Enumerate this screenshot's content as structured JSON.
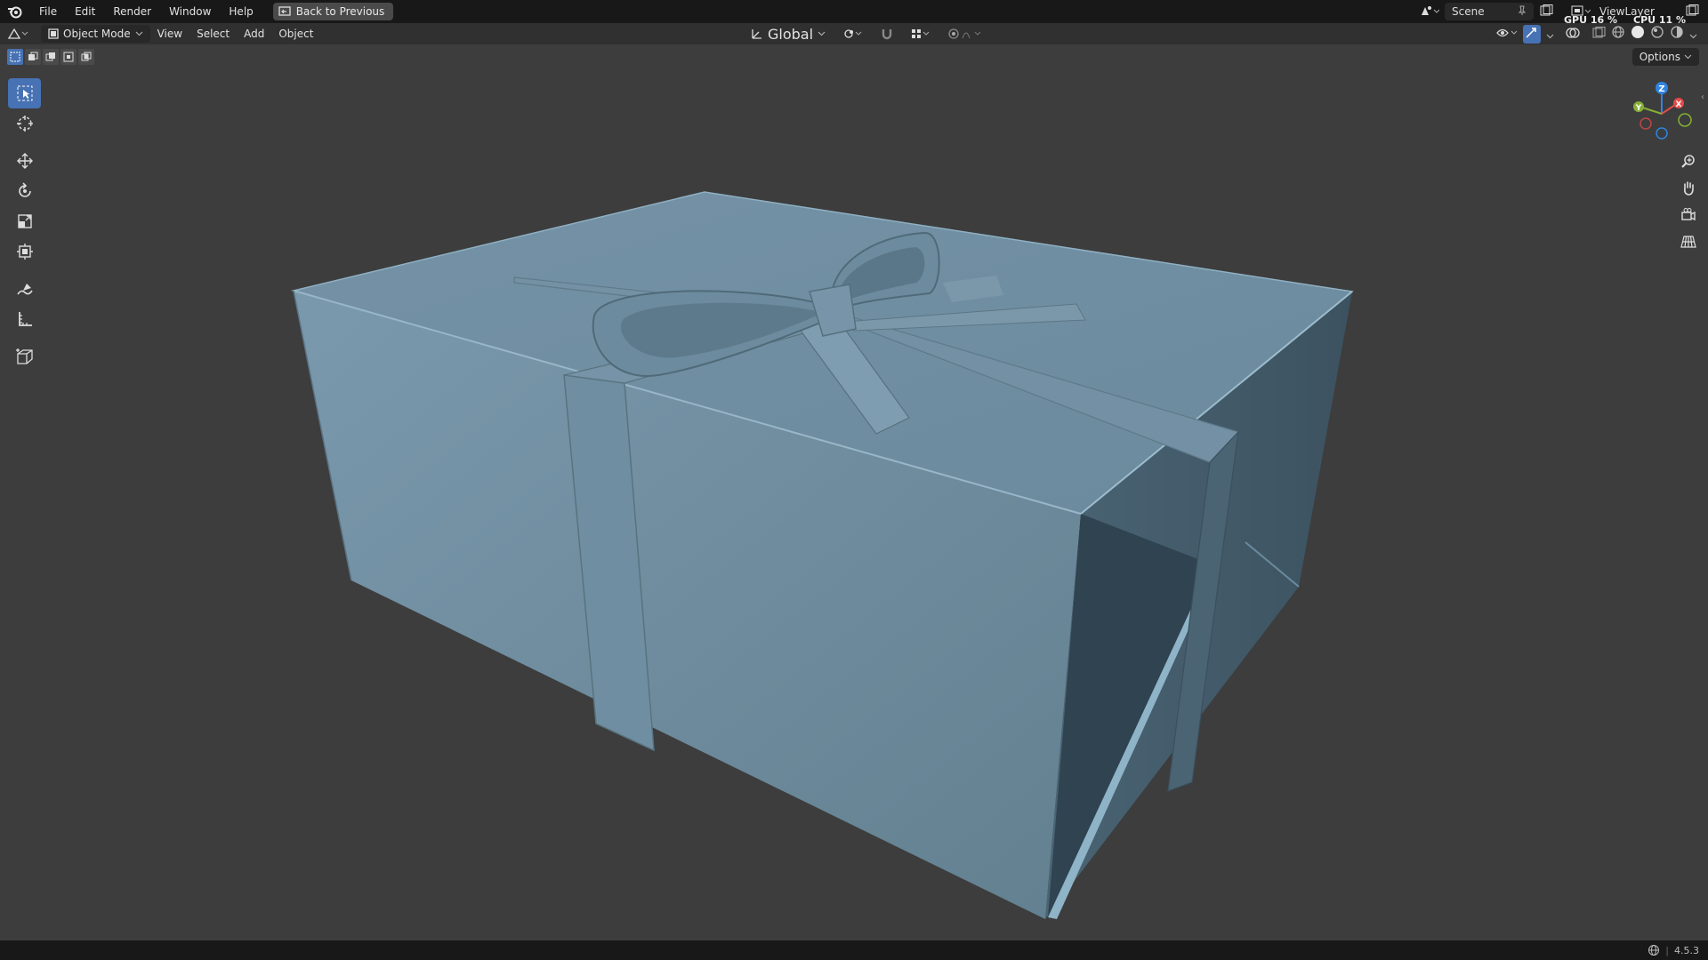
{
  "menus": {
    "file": "File",
    "edit": "Edit",
    "render": "Render",
    "window": "Window",
    "help": "Help"
  },
  "back_button": "Back to Previous",
  "scene": {
    "name": "Scene"
  },
  "view_layer": {
    "name": "ViewLayer"
  },
  "stats": {
    "gpu": "GPU  16 %",
    "cpu": "CPU  11 %"
  },
  "header": {
    "mode": "Object Mode",
    "view": "View",
    "select": "Select",
    "add": "Add",
    "object": "Object",
    "orientation": "Global"
  },
  "options": "Options",
  "version": "4.5.3",
  "gizmo": {
    "x": "X",
    "y": "Y",
    "z": "Z"
  },
  "colors": {
    "accent": "#4772b3",
    "object": "#6d8a9d",
    "background": "#3d3d3d",
    "axis_x": "#e34b4b",
    "axis_y": "#86b036",
    "axis_z": "#2f84e3"
  },
  "icons": {
    "tools": [
      "select-box-icon",
      "cursor-icon",
      "move-icon",
      "rotate-icon",
      "scale-icon",
      "transform-icon",
      "annotate-icon",
      "measure-icon",
      "add-cube-icon"
    ],
    "nav": [
      "zoom-icon",
      "pan-hand-icon",
      "camera-icon",
      "grid-icon"
    ]
  }
}
